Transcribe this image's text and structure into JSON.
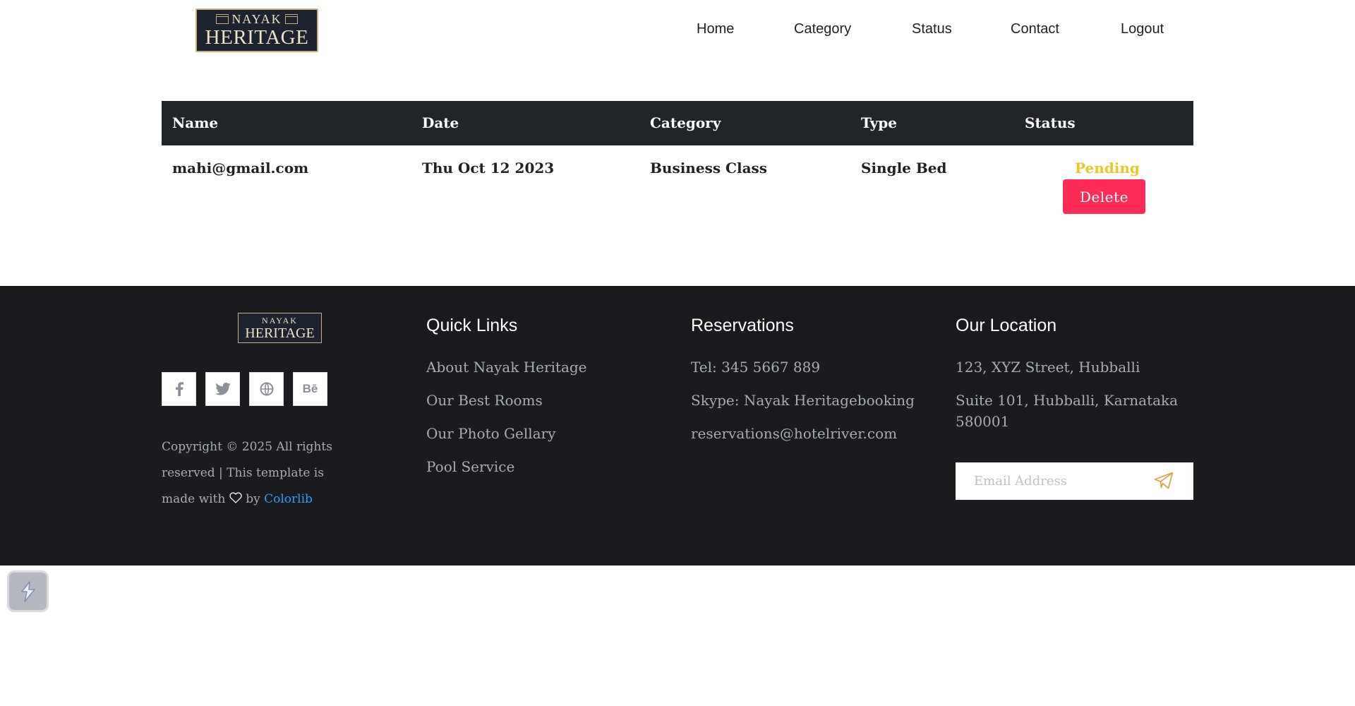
{
  "header": {
    "logo": {
      "top_text": "NAYAK",
      "bottom_text": "HERITAGE"
    },
    "nav": [
      "Home",
      "Category",
      "Status",
      "Contact",
      "Logout"
    ]
  },
  "table": {
    "headers": [
      "Name",
      "Date",
      "Category",
      "Type",
      "Status"
    ],
    "rows": [
      {
        "name": "mahi@gmail.com",
        "date": "Thu Oct 12 2023",
        "category": "Business Class",
        "type": "Single Bed",
        "status": "Pending",
        "action": "Delete"
      }
    ]
  },
  "footer": {
    "logo": {
      "top_text": "NAYAK",
      "bottom_text": "HERITAGE"
    },
    "socials": [
      {
        "icon": "facebook-icon",
        "glyph": "f"
      },
      {
        "icon": "twitter-icon",
        "glyph": "t"
      },
      {
        "icon": "dribbble-icon",
        "glyph": "globe"
      },
      {
        "icon": "behance-icon",
        "glyph": "Bē"
      }
    ],
    "copyright": {
      "part1": "Copyright © 2025 All rights reserved | This template is made with",
      "part2": "by",
      "link": "Colorlib"
    },
    "quick_links": {
      "title": "Quick Links",
      "items": [
        "About Nayak Heritage",
        "Our Best Rooms",
        "Our Photo Gellary",
        "Pool Service"
      ]
    },
    "reservations": {
      "title": "Reservations",
      "items": [
        "Tel: 345 5667 889",
        "Skype: Nayak Heritagebooking",
        "reservations@hotelriver.com"
      ]
    },
    "location": {
      "title": "Our Location",
      "items": [
        "123, XYZ Street, Hubballi",
        "Suite 101, Hubballi, Karnataka 580001"
      ],
      "email_placeholder": "Email Address"
    }
  },
  "colors": {
    "table_header_bg": "#212529",
    "pending": "#e8c920",
    "delete_button": "#ff2b57",
    "footer_bg": "#1a1b1f",
    "link": "#2f9bff",
    "send_icon": "#d9a441"
  }
}
